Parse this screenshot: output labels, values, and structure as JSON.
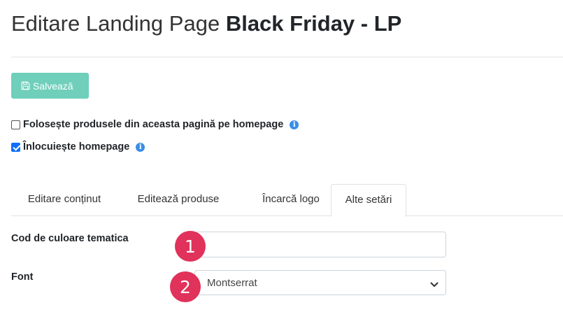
{
  "header": {
    "title_prefix": "Editare Landing Page",
    "title_name": "Black Friday - LP"
  },
  "toolbar": {
    "save_label": "Salvează",
    "save_icon": "floppy-disk-icon"
  },
  "options": [
    {
      "label": "Folosește produsele din aceasta pagină pe homepage",
      "checked": false,
      "icon": "info-icon"
    },
    {
      "label": "Înlocuiește homepage",
      "checked": true,
      "icon": "info-icon"
    }
  ],
  "tabs": [
    {
      "label": "Editare conținut",
      "active": false
    },
    {
      "label": "Editează produse",
      "active": false
    },
    {
      "label": "Încarcă logo",
      "active": false
    },
    {
      "label": "Alte setări",
      "active": true
    }
  ],
  "form": {
    "color_label": "Cod de culoare tematica",
    "color_value": "",
    "font_label": "Font",
    "font_value": "Montserrat"
  },
  "markers": [
    "1",
    "2"
  ],
  "colors": {
    "save_button": "#6fcfbb",
    "marker": "#e0325a",
    "info": "#3a8ee6",
    "checkbox": "#0d6efd"
  }
}
